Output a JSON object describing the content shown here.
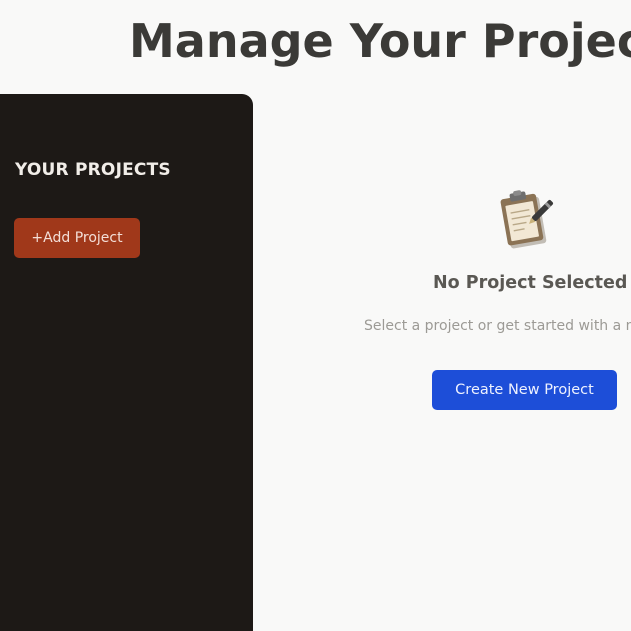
{
  "header": {
    "title": "Manage Your Projects"
  },
  "sidebar": {
    "heading": "YOUR PROJECTS",
    "add_button_label": "+Add Project"
  },
  "main": {
    "empty_state": {
      "icon": "clipboard-icon",
      "title": "No Project Selected",
      "text": "Select a project or get started with a new one",
      "button_label": "Create New Project"
    }
  },
  "colors": {
    "page_background": "#f9f9f8",
    "sidebar_background": "#1d1916",
    "add_button": "#a0381a",
    "primary_button": "#1d4ed8",
    "title_text": "#3b3a37"
  }
}
